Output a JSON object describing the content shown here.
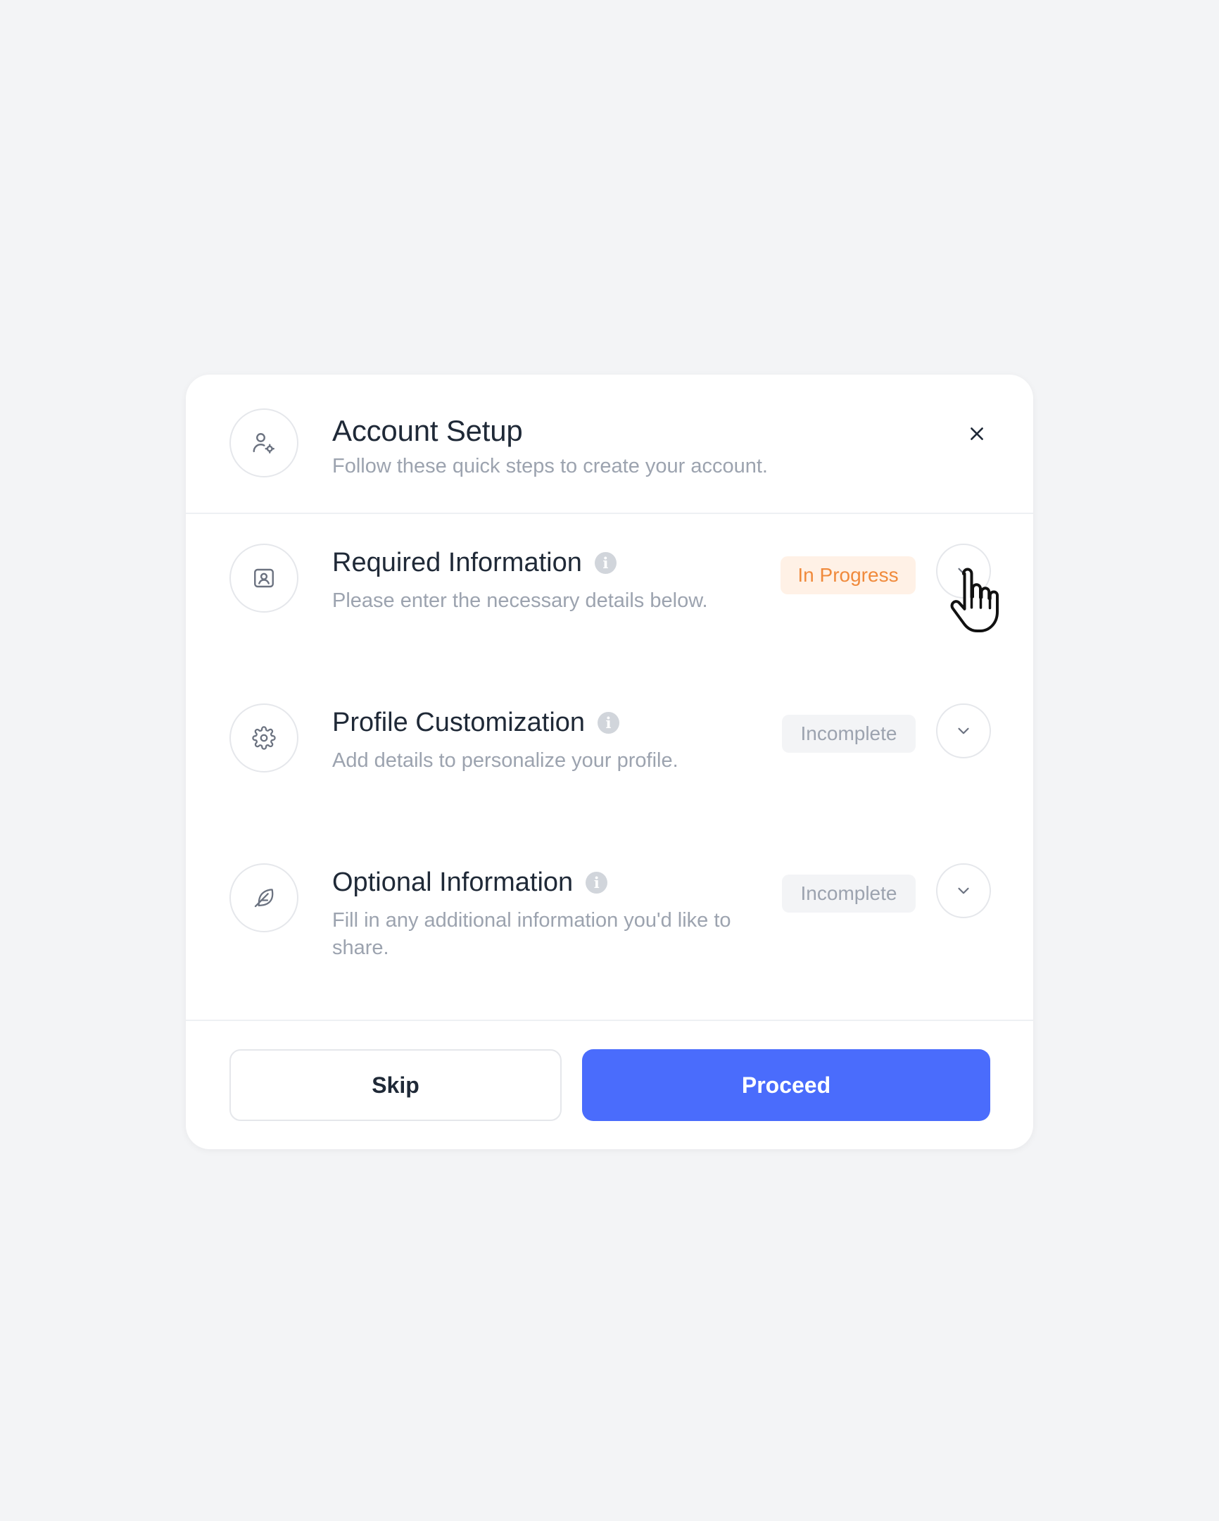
{
  "header": {
    "icon": "user-gear-icon",
    "title": "Account Setup",
    "subtitle": "Follow these quick steps to create your account.",
    "close_icon": "close-icon"
  },
  "steps": [
    {
      "icon": "id-card-icon",
      "title": "Required Information",
      "description": "Please enter the necessary details below.",
      "status": "In Progress",
      "status_color": "#f08a3c",
      "status_bg": "#fff1e6",
      "expand_icon": "chevron-down-icon"
    },
    {
      "icon": "gear-icon",
      "title": "Profile Customization",
      "description": "Add details to personalize your profile.",
      "status": "Incomplete",
      "status_color": "#9ca3af",
      "status_bg": "#f3f4f6",
      "expand_icon": "chevron-down-icon"
    },
    {
      "icon": "feather-icon",
      "title": "Optional Information",
      "description": "Fill in any additional information you'd like to share.",
      "status": "Incomplete",
      "status_color": "#9ca3af",
      "status_bg": "#f3f4f6",
      "expand_icon": "chevron-down-icon"
    }
  ],
  "footer": {
    "skip_label": "Skip",
    "proceed_label": "Proceed",
    "proceed_color": "#4a6cfc"
  },
  "cursor": "hand-pointer-icon"
}
